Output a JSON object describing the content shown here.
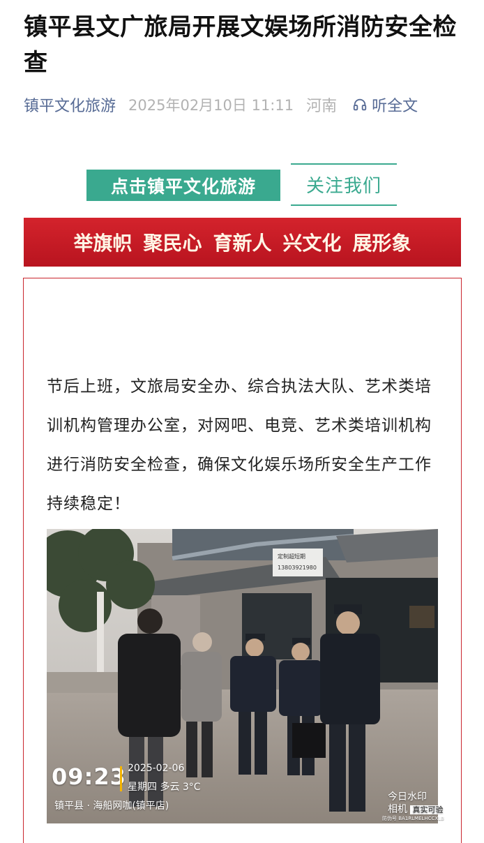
{
  "article": {
    "title": "镇平县文广旅局开展文娱场所消防安全检查",
    "account": "镇平文化旅游",
    "datetime": "2025年02月10日 11:11",
    "region": "河南",
    "listen_label": "听全文",
    "follow_button": "点击镇平文化旅游",
    "follow_us": "关注我们",
    "banner_phrases": [
      "举旗帜",
      "聚民心",
      "育新人",
      "兴文化",
      "展形象"
    ],
    "body": "节后上班，文旅局安全办、综合执法大队、艺术类培训机构管理办公室，对网吧、电竞、艺术类培训机构进行消防安全检查，确保文化娱乐场所安全生产工作持续稳定！"
  },
  "photo": {
    "shop_sign_text": "定制超短期\n13803921980",
    "watermark_time": "09:23",
    "watermark_date": "2025-02-06",
    "watermark_weather": "星期四  多云 3°C",
    "watermark_location": "镇平县 · 海船网咖(镇平店)",
    "watermark_app": "今日水印",
    "watermark_app_sub": "相机",
    "watermark_verified": "真实可验",
    "watermark_code": "防伪号 BA1RLMELHCCXLB"
  },
  "colors": {
    "accent_green": "#3aa98f",
    "link_blue": "#576b95",
    "banner_red": "#c81b25"
  }
}
